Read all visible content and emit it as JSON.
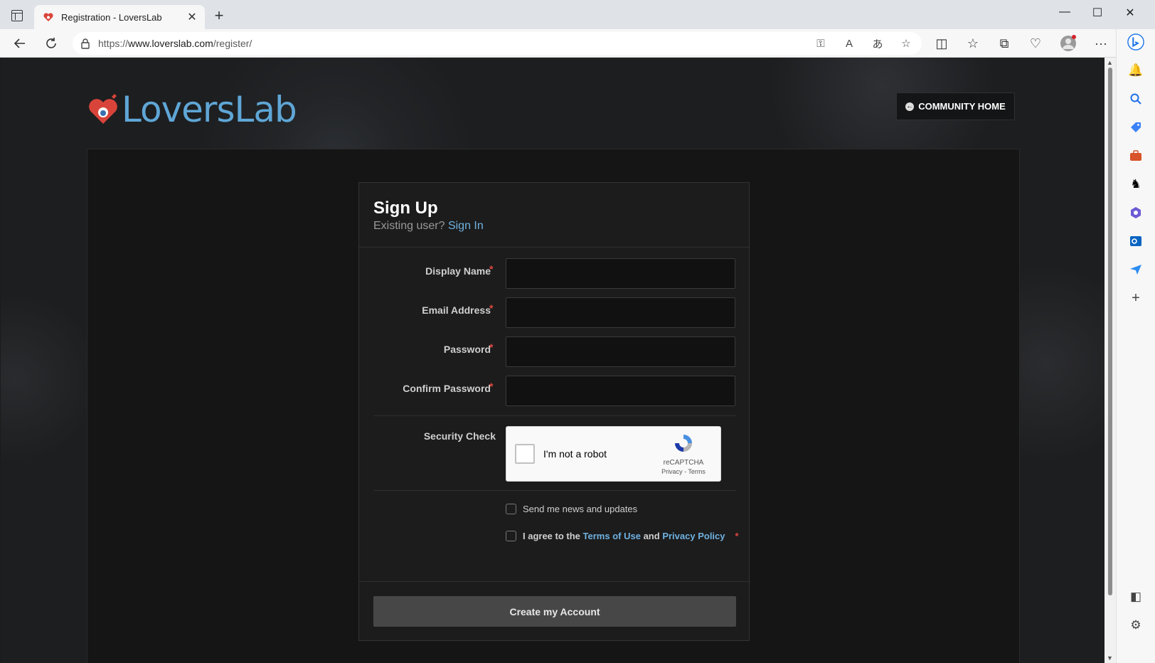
{
  "browser": {
    "tab_title": "Registration - LoversLab",
    "url_scheme": "https://",
    "url_host": "www.loverslab.com",
    "url_path": "/register/"
  },
  "site": {
    "logo_text": "LoversLab",
    "community_home_label": "COMMUNITY HOME"
  },
  "signup": {
    "title": "Sign Up",
    "existing_prompt": "Existing user?",
    "sign_in_link": "Sign In",
    "fields": [
      {
        "label": "Display Name",
        "required": "*",
        "value": ""
      },
      {
        "label": "Email Address",
        "required": "*",
        "value": ""
      },
      {
        "label": "Password",
        "required": "*",
        "value": ""
      },
      {
        "label": "Confirm Password",
        "required": "*",
        "value": ""
      }
    ],
    "security_label": "Security Check",
    "recaptcha": {
      "checkbox_label": "I'm not a robot",
      "brand": "reCAPTCHA",
      "privacy": "Privacy",
      "separator": " - ",
      "terms": "Terms"
    },
    "news_checkbox": "Send me news and updates",
    "agree_prefix": "I agree to the",
    "terms_link": "Terms of Use",
    "agree_and": "and",
    "privacy_link": "Privacy Policy",
    "agree_required": "*",
    "submit_label": "Create my Account"
  },
  "colors": {
    "accent_link": "#6fb1e0",
    "required": "#e0463f",
    "logo": "#5fa6d6"
  }
}
